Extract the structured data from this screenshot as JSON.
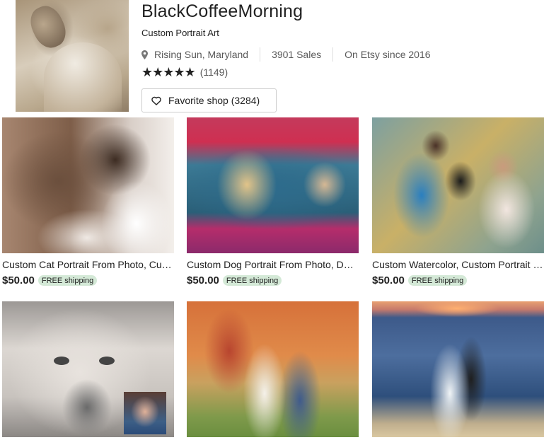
{
  "shop": {
    "name": "BlackCoffeeMorning",
    "tagline": "Custom Portrait Art",
    "location": "Rising Sun, Maryland",
    "sales": "3901 Sales",
    "since": "On Etsy since 2016",
    "stars": "★★★★★",
    "rating_count": "(1149)",
    "rating_value": 5,
    "favorite_label": "Favorite shop (3284)"
  },
  "colors": {
    "shipping_badge_bg": "#d4e9d7",
    "text": "#222222",
    "muted": "#595959"
  },
  "icons": {
    "location": "map-pin-icon",
    "favorite": "heart-outline-icon",
    "rating": "star-icon"
  },
  "listings": [
    {
      "title": "Custom Cat Portrait From Photo, Custom Cat Painting",
      "price": "$50.00",
      "badge": "FREE shipping"
    },
    {
      "title": "Custom Dog Portrait From Photo, Dog Painting",
      "price": "$50.00",
      "badge": "FREE shipping"
    },
    {
      "title": "Custom Watercolor, Custom Portrait Painting",
      "price": "$50.00",
      "badge": "FREE shipping"
    },
    {
      "title": "",
      "price": "",
      "badge": ""
    },
    {
      "title": "",
      "price": "",
      "badge": ""
    },
    {
      "title": "",
      "price": "",
      "badge": ""
    }
  ]
}
